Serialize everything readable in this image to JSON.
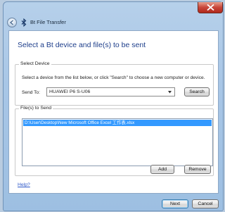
{
  "window": {
    "title": "Bt File Transfer"
  },
  "main": {
    "heading": "Select a Bt device and file(s) to be sent",
    "select_device": {
      "legend": "Select Device",
      "instructions": "Select a device from the list below, or click \"Search\" to choose a new computer or device.",
      "send_to_label": "Send To:",
      "send_to_value": "HUAWEI P6 S-U06",
      "search_label": "Search"
    },
    "files": {
      "legend": "File(s) to Send",
      "items": [
        "D:\\User\\Desktop\\New Microsoft Office Excel 工作表.xlsx"
      ],
      "add_label": "Add",
      "remove_label": "Remove"
    },
    "help_label": "Help?"
  },
  "footer": {
    "next_label": "Next",
    "cancel_label": "Cancel"
  },
  "colors": {
    "heading": "#1c3d8a",
    "selection": "#3399ff",
    "link": "#2a55c8",
    "close_button": "#c8463a"
  }
}
